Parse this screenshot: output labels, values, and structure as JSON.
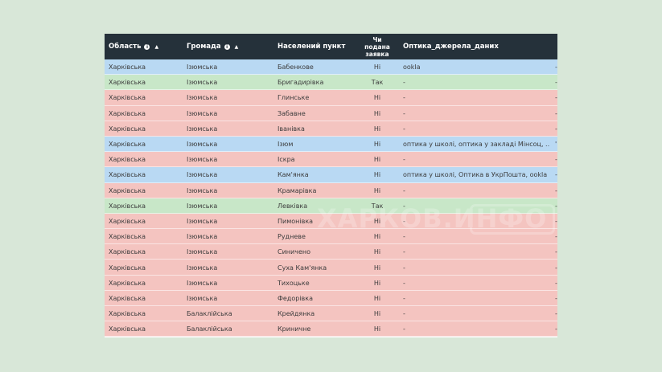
{
  "table": {
    "headers": {
      "region": "Область",
      "hromada": "Громада",
      "settlement": "Населений пункт",
      "application_line1": "Чи",
      "application_line2": "подана",
      "application_line3": "заявка",
      "optics": "Оптика_джерела_даних"
    },
    "rows": [
      {
        "region": "Харківська",
        "hromada": "Ізюмська",
        "settlement": "Бабенкове",
        "application": "Ні",
        "optics": "ookla",
        "edge": "-",
        "status": "blue"
      },
      {
        "region": "Харківська",
        "hromada": "Ізюмська",
        "settlement": "Бригадирівка",
        "application": "Так",
        "optics": "-",
        "edge": "-",
        "status": "green"
      },
      {
        "region": "Харківська",
        "hromada": "Ізюмська",
        "settlement": "Глинське",
        "application": "Ні",
        "optics": "-",
        "edge": "-",
        "status": "red"
      },
      {
        "region": "Харківська",
        "hromada": "Ізюмська",
        "settlement": "Забавне",
        "application": "Ні",
        "optics": "-",
        "edge": "-",
        "status": "red"
      },
      {
        "region": "Харківська",
        "hromada": "Ізюмська",
        "settlement": "Іванівка",
        "application": "Ні",
        "optics": "-",
        "edge": "-",
        "status": "red"
      },
      {
        "region": "Харківська",
        "hromada": "Ізюмська",
        "settlement": "Ізюм",
        "application": "Ні",
        "optics": "оптика у школі, оптика у закладі Мінсоц, ...",
        "edge": "'",
        "status": "blue"
      },
      {
        "region": "Харківська",
        "hromada": "Ізюмська",
        "settlement": "Іскра",
        "application": "Ні",
        "optics": "-",
        "edge": "-",
        "status": "red"
      },
      {
        "region": "Харківська",
        "hromada": "Ізюмська",
        "settlement": "Кам'янка",
        "application": "Ні",
        "optics": "оптика у школі, Оптика в УкрПошта, ookla",
        "edge": "-",
        "status": "blue"
      },
      {
        "region": "Харківська",
        "hromada": "Ізюмська",
        "settlement": "Крамарівка",
        "application": "Ні",
        "optics": "-",
        "edge": "-",
        "status": "red"
      },
      {
        "region": "Харківська",
        "hromada": "Ізюмська",
        "settlement": "Левківка",
        "application": "Так",
        "optics": "-",
        "edge": "-",
        "status": "green"
      },
      {
        "region": "Харківська",
        "hromada": "Ізюмська",
        "settlement": "Пимонівка",
        "application": "Ні",
        "optics": "-",
        "edge": "-",
        "status": "red"
      },
      {
        "region": "Харківська",
        "hromada": "Ізюмська",
        "settlement": "Рудневе",
        "application": "Ні",
        "optics": "-",
        "edge": "-",
        "status": "red"
      },
      {
        "region": "Харківська",
        "hromada": "Ізюмська",
        "settlement": "Синичено",
        "application": "Ні",
        "optics": "-",
        "edge": "-",
        "status": "red"
      },
      {
        "region": "Харківська",
        "hromada": "Ізюмська",
        "settlement": "Суха Кам'янка",
        "application": "Ні",
        "optics": "-",
        "edge": "-",
        "status": "red"
      },
      {
        "region": "Харківська",
        "hromada": "Ізюмська",
        "settlement": "Тихоцьке",
        "application": "Ні",
        "optics": "-",
        "edge": "-",
        "status": "red"
      },
      {
        "region": "Харківська",
        "hromada": "Ізюмська",
        "settlement": "Федорівка",
        "application": "Ні",
        "optics": "-",
        "edge": "-",
        "status": "red"
      },
      {
        "region": "Харківська",
        "hromada": "Балаклійська",
        "settlement": "Крейдянка",
        "application": "Ні",
        "optics": "-",
        "edge": "-",
        "status": "red"
      },
      {
        "region": "Харківська",
        "hromada": "Балаклійська",
        "settlement": "Криничне",
        "application": "Ні",
        "optics": "-",
        "edge": "-",
        "status": "red"
      }
    ]
  },
  "icons": {
    "info_glyph": "i",
    "sort_glyph": "▲"
  },
  "watermark": {
    "text": "ХАРКОВ.ИНФО"
  },
  "colors": {
    "header_bg": "#25313a",
    "row_blue": "#b9d9f3",
    "row_green": "#c8e7c8",
    "row_red": "#f4c4c0",
    "page_bg": "#d8e7d8"
  }
}
